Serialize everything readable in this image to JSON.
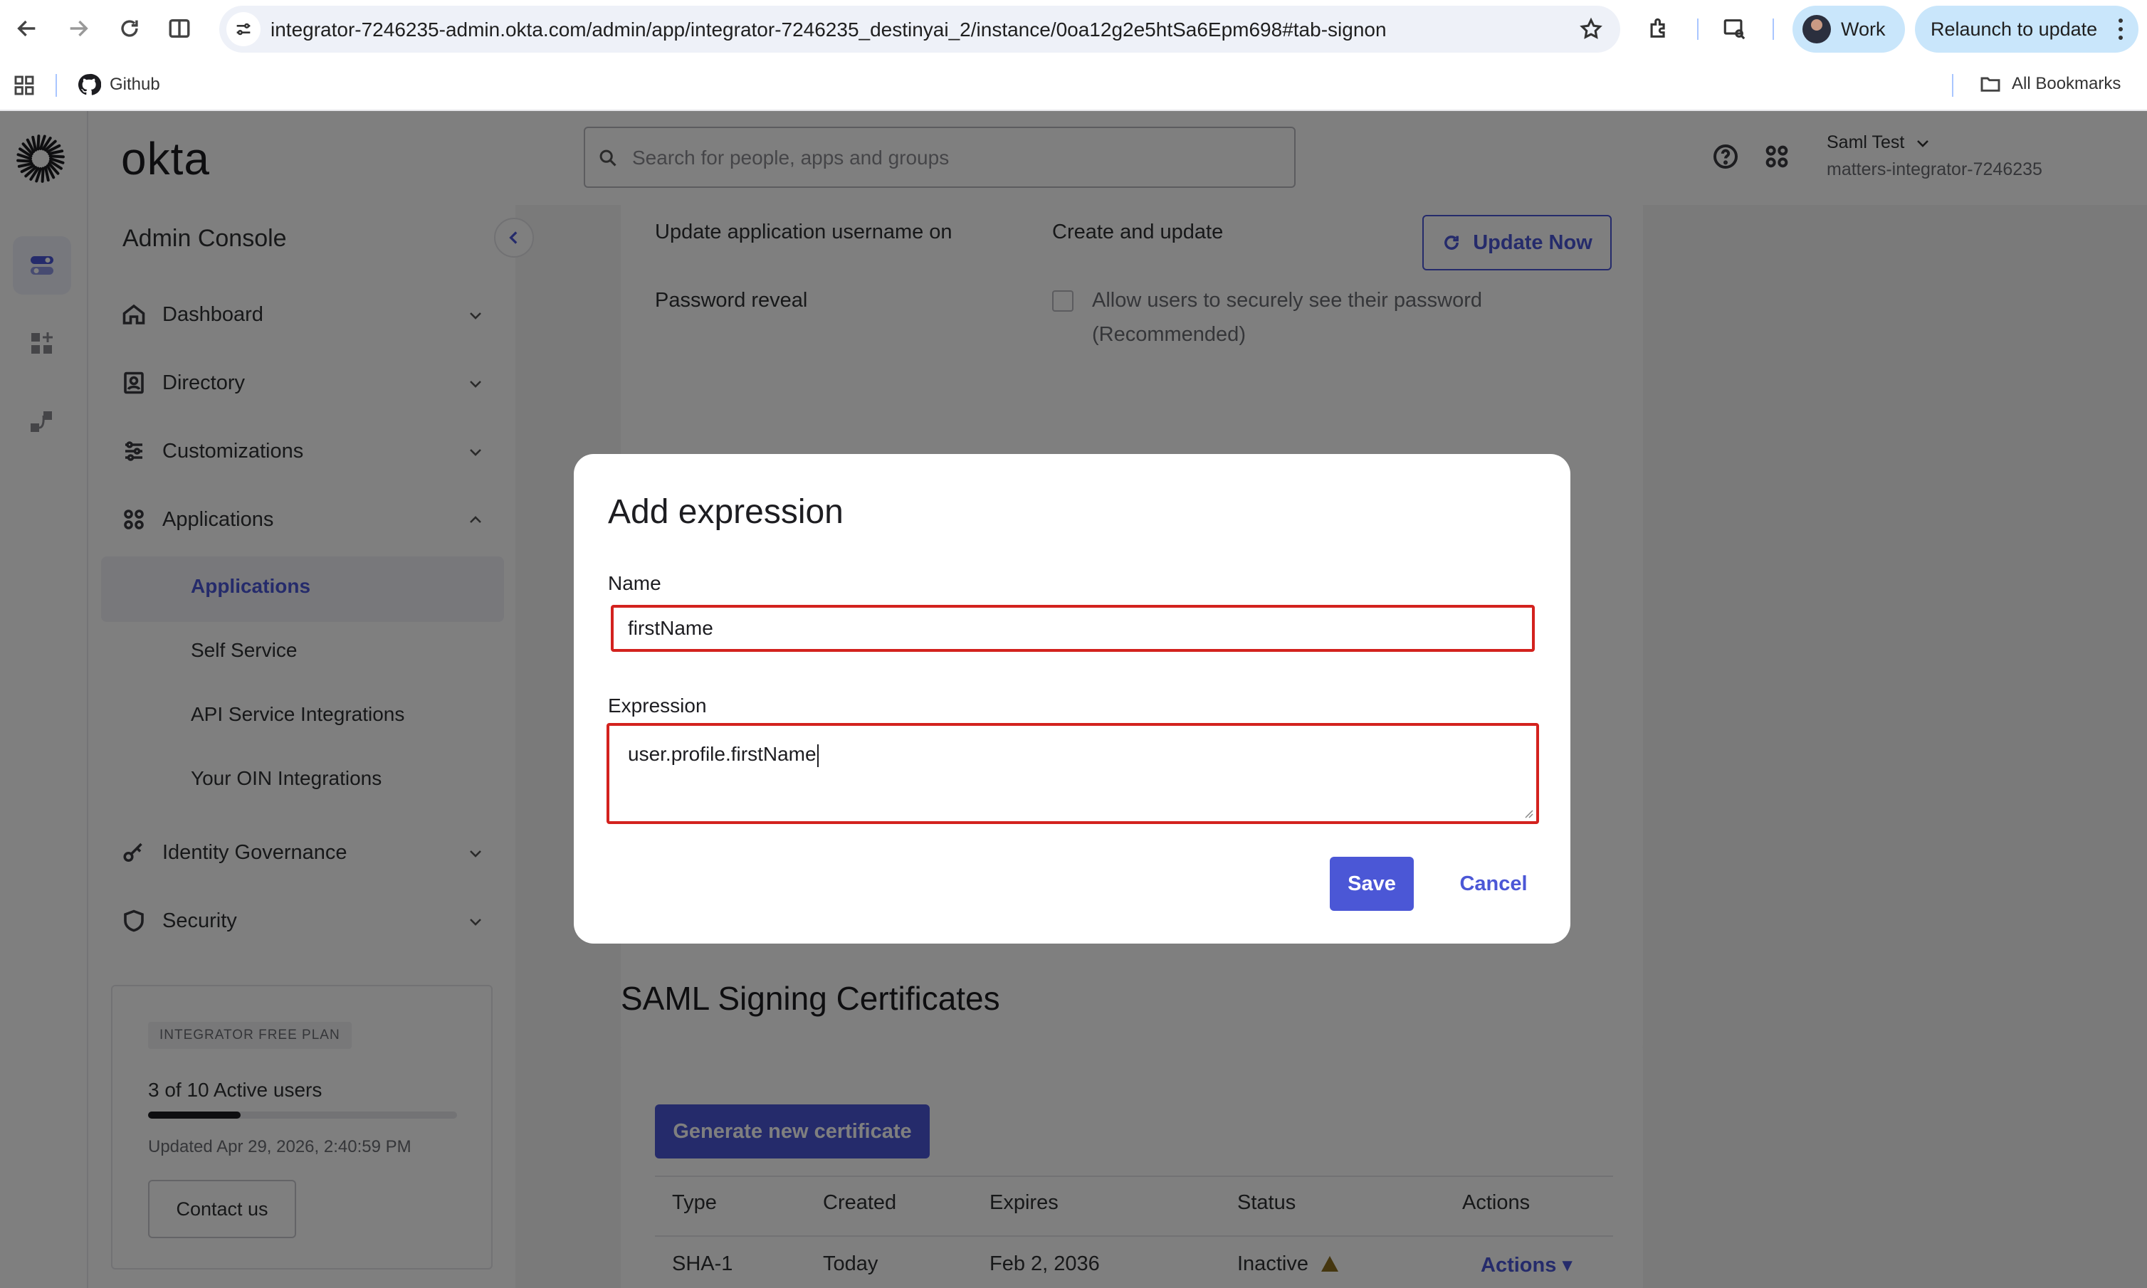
{
  "browser": {
    "url": "integrator-7246235-admin.okta.com/admin/app/integrator-7246235_destinyai_2/instance/0oa12g2e5htSa6Epm698#tab-signon",
    "profile_label": "Work",
    "relaunch_label": "Relaunch to update",
    "bookmarks": {
      "github": "Github",
      "all": "All Bookmarks"
    }
  },
  "brand": {
    "wordmark": "okta",
    "console_title": "Admin Console",
    "accent": "#4b57d6"
  },
  "header": {
    "search_placeholder": "Search for people, apps and groups",
    "user_name": "Saml Test",
    "org": "matters-integrator-7246235"
  },
  "sidebar": {
    "items": [
      {
        "label": "Dashboard"
      },
      {
        "label": "Directory"
      },
      {
        "label": "Customizations"
      },
      {
        "label": "Applications"
      },
      {
        "label": "Identity Governance"
      },
      {
        "label": "Security"
      }
    ],
    "subitems": [
      {
        "label": "Applications"
      },
      {
        "label": "Self Service"
      },
      {
        "label": "API Service Integrations"
      },
      {
        "label": "Your OIN Integrations"
      }
    ],
    "plan": {
      "badge": "INTEGRATOR FREE PLAN",
      "users": "3 of 10 Active users",
      "users_fraction": 0.3,
      "updated": "Updated Apr 29, 2026, 2:40:59 PM",
      "contact": "Contact us"
    }
  },
  "content": {
    "update_username_label": "Update application username on",
    "update_username_value": "Create and update",
    "update_now": "Update Now",
    "password_reveal_label": "Password reveal",
    "password_reveal_line1": "Allow users to securely see their password",
    "password_reveal_line2": "(Recommended)",
    "signing_title": "SAML Signing Certificates",
    "generate_cert": "Generate new certificate",
    "table": {
      "headers": [
        "Type",
        "Created",
        "Expires",
        "Status",
        "Actions"
      ],
      "row": {
        "type": "SHA-1",
        "created": "Today",
        "expires": "Feb 2, 2036",
        "status": "Inactive",
        "actions": "Actions ▾"
      }
    }
  },
  "modal": {
    "title": "Add expression",
    "name_label": "Name",
    "name_value": "firstName",
    "expression_label": "Expression",
    "expression_value": "user.profile.firstName",
    "save": "Save",
    "cancel": "Cancel"
  }
}
